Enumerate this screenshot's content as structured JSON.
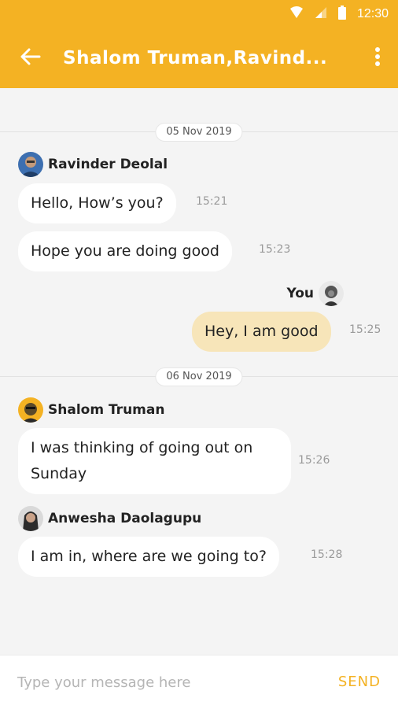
{
  "status_bar": {
    "time": "12:30",
    "icons": [
      "wifi-icon",
      "signal-icon",
      "battery-icon"
    ]
  },
  "header": {
    "title": "Shalom Truman,Ravind...",
    "back_icon": "arrow-left-icon",
    "menu_icon": "more-vert-icon"
  },
  "colors": {
    "accent": "#f4b223",
    "own_bubble": "#f7e5b9",
    "bubble": "#ffffff",
    "background": "#f4f4f4"
  },
  "conversation": {
    "dates": [
      "05 Nov 2019",
      "06 Nov 2019"
    ],
    "senders": [
      "Ravinder Deolal",
      "You",
      "Shalom Truman",
      "Anwesha Daolagupu"
    ],
    "messages": [
      {
        "text": "Hello, How’s you?",
        "time": "15:21"
      },
      {
        "text": "Hope you are doing good",
        "time": "15:23"
      },
      {
        "text": "Hey, I am good",
        "time": "15:25"
      },
      {
        "text": "I was thinking of going out on Sunday",
        "time": "15:26"
      },
      {
        "text": "I am in, where are we going to?",
        "time": "15:28"
      }
    ]
  },
  "composer": {
    "placeholder": "Type your message here",
    "send_label": "SEND"
  }
}
